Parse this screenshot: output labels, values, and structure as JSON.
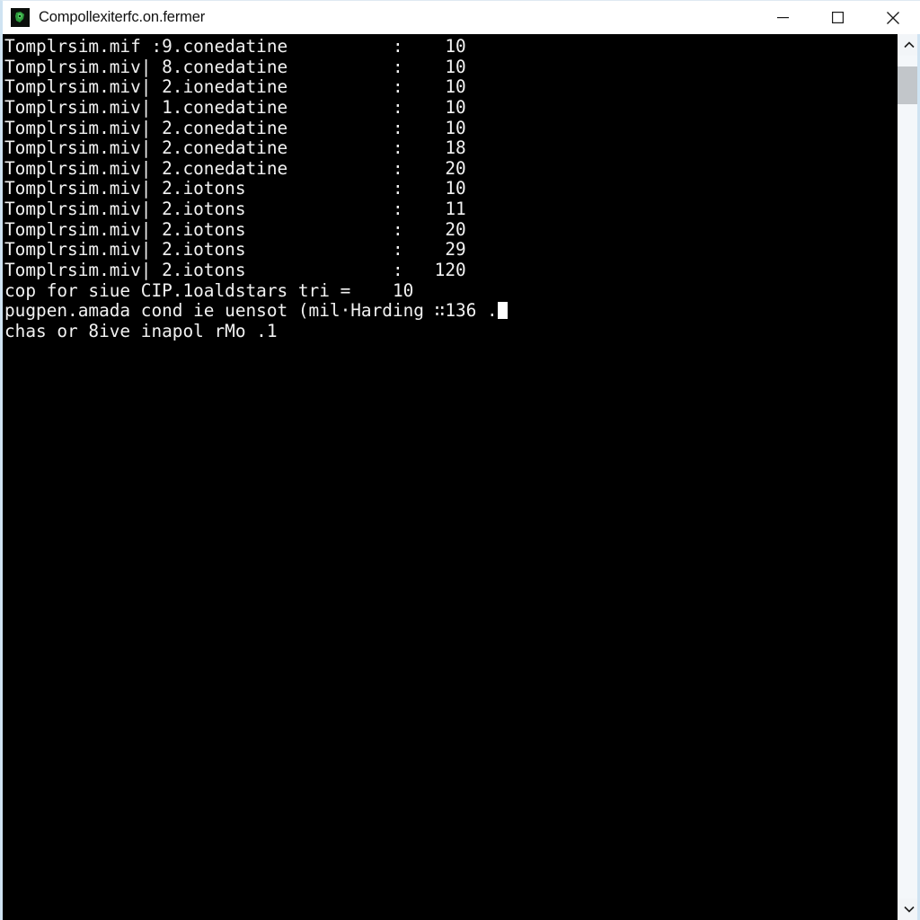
{
  "window": {
    "title": "Compollexiterfc.on.fermer",
    "icon": "terminal-app-icon",
    "controls": {
      "minimize": "minimize-icon",
      "maximize": "maximize-icon",
      "close": "close-icon"
    }
  },
  "console": {
    "background_color": "#000000",
    "text_color": "#f2f2f2",
    "lines": [
      "Tomplrsim.mif :9.conedatine          :    10",
      "Tomplrsim.miv| 8.conedatine          :    10",
      "Tomplrsim.miv| 2.ionedatine          :    10",
      "Tomplrsim.miv| 1.conedatine          :    10",
      "Tomplrsim.miv| 2.conedatine          :    10",
      "Tomplrsim.miv| 2.conedatine          :    18",
      "Tomplrsim.miv| 2.conedatine          :    20",
      "Tomplrsim.miv| 2.iotons              :    10",
      "Tomplrsim.miv| 2.iotons              :    11",
      "Tomplrsim.miv| 2.iotons              :    20",
      "Tomplrsim.miv| 2.iotons              :    29",
      "Tomplrsim.miv| 2.iotons              :   120",
      "cop for siue CIP.1oaldstars tri =    10",
      "pugpen.amada cond ie uensot (mil·Harding ∷136 .",
      "chas or 8ive inapol rMo .1"
    ],
    "cursor_line_index": 13,
    "cursor_char": "block-cursor"
  },
  "scrollbar": {
    "up_arrow": "chevron-up-icon",
    "down_arrow": "chevron-down-icon",
    "thumb": "scrollbar-thumb"
  }
}
